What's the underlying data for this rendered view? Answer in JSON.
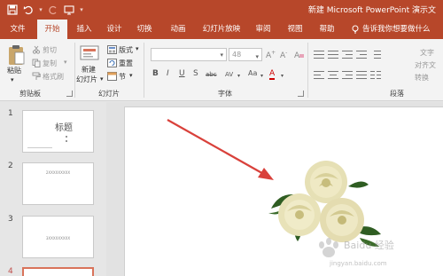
{
  "app": {
    "title": "新建 Microsoft PowerPoint 演示文",
    "accent_color": "#b7472a"
  },
  "quick_access": {
    "save_icon": "save-icon",
    "undo_icon": "undo-icon",
    "redo_icon": "redo-icon",
    "presentation_icon": "start-from-beginning-icon"
  },
  "tabs": [
    "文件",
    "开始",
    "插入",
    "设计",
    "切换",
    "动画",
    "幻灯片放映",
    "审阅",
    "视图",
    "帮助"
  ],
  "active_tab": "开始",
  "tell_me": "告诉我你想要做什么",
  "ribbon": {
    "clipboard": {
      "label": "剪贴板",
      "paste": "粘贴",
      "cut": "剪切",
      "copy": "复制",
      "format_painter": "格式刷"
    },
    "slides": {
      "label": "幻灯片",
      "new_slide_line1": "新建",
      "new_slide_line2": "幻灯片",
      "layout": "版式",
      "reset": "重置",
      "section": "节"
    },
    "font": {
      "label": "字体",
      "font_name": "",
      "font_size": "48",
      "bold": "B",
      "italic": "I",
      "underline": "U",
      "strike": "S",
      "shadow": "abc",
      "spacing": "AV",
      "case": "Aa",
      "font_color": "A"
    },
    "paragraph": {
      "label": "段落",
      "text_direction": "文字",
      "align_text": "对齐文",
      "convert_smartart": "转换"
    }
  },
  "slides_pane": [
    {
      "number": "1",
      "title": "标题",
      "selected": false
    },
    {
      "number": "2",
      "text": "2XXXXXXXXX",
      "selected": false
    },
    {
      "number": "3",
      "text": "3XXXXXXXXX",
      "selected": false
    },
    {
      "number": "4",
      "selected": true
    }
  ],
  "watermark": {
    "text": "Baidu 经验",
    "url": "jingyan.baidu.com"
  }
}
